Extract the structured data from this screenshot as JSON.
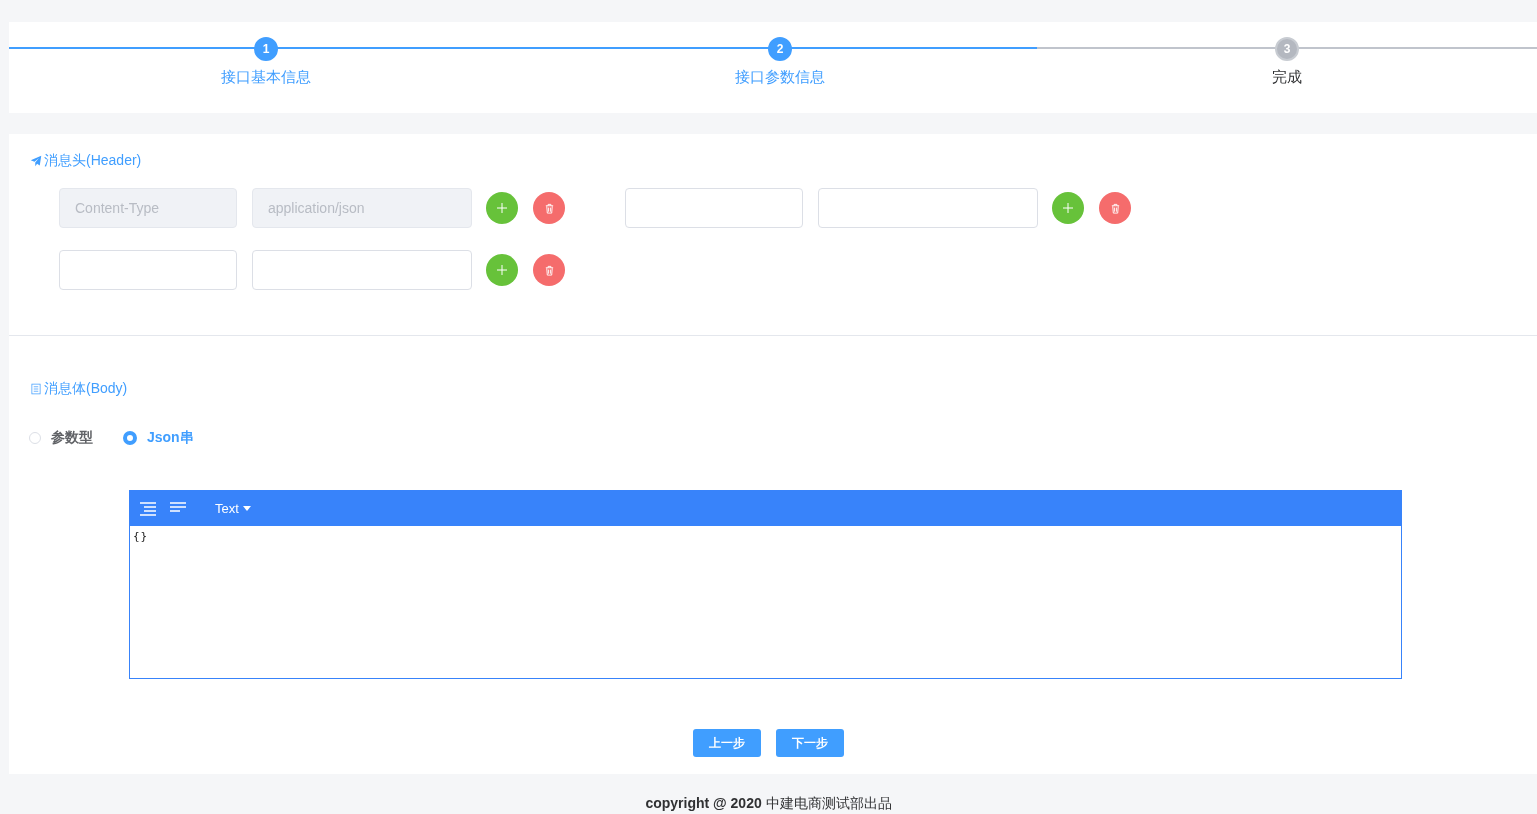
{
  "steps": [
    {
      "number": "1",
      "label": "接口基本信息",
      "finished": true
    },
    {
      "number": "2",
      "label": "接口参数信息",
      "finished": true
    },
    {
      "number": "3",
      "label": "完成",
      "finished": false
    }
  ],
  "header_section": {
    "title": "消息头(Header)",
    "pairs": [
      {
        "key": "Content-Type",
        "value": "application/json",
        "disabled": true
      },
      {
        "disabled": false
      },
      {
        "disabled": false
      }
    ]
  },
  "body_section": {
    "title": "消息体(Body)",
    "radios": [
      {
        "label": "参数型",
        "selected": false
      },
      {
        "label": "Json串",
        "selected": true
      }
    ],
    "editor": {
      "mode": "Text",
      "content": "{}"
    }
  },
  "buttons": [
    {
      "label": "上一步"
    },
    {
      "label": "下一步"
    }
  ],
  "footer": {
    "text": "**copyright @ 2020** 中建电商测试部出品"
  }
}
